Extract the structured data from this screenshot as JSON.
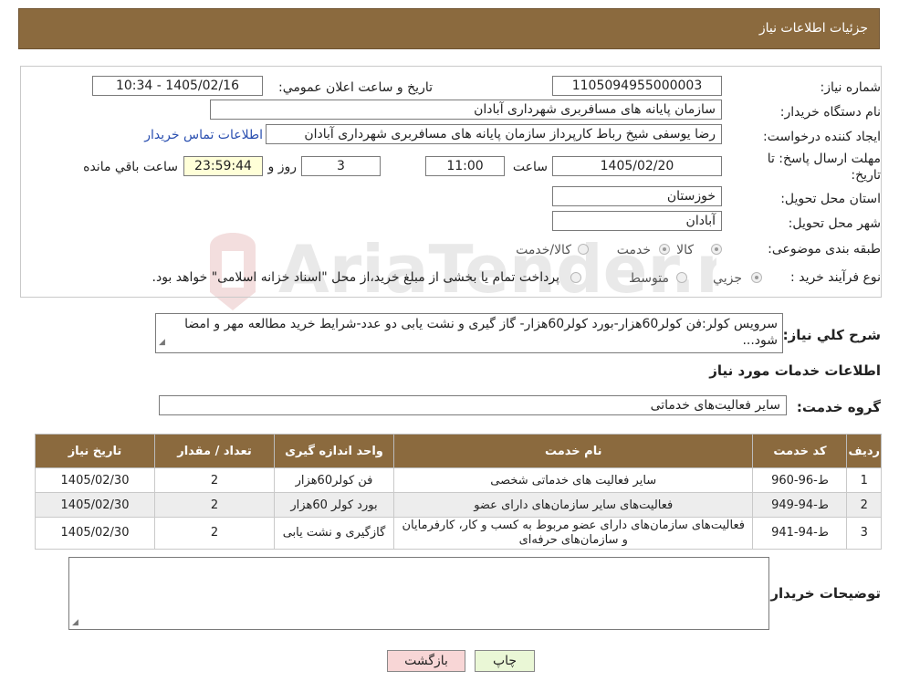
{
  "header": {
    "title": "جزئيات اطلاعات نياز"
  },
  "fields": {
    "need_number_label": "شماره نياز:",
    "need_number": "1105094955000003",
    "announce_label": "تاريخ و ساعت اعلان عمومي:",
    "announce_value": "1405/02/16 - 10:34",
    "buyer_label": "نام دستگاه خريدار:",
    "buyer_value": "سازمان پایانه های مسافربری شهرداری آبادان",
    "creator_label": "ايجاد کننده درخواست:",
    "creator_value": "رضا یوسفی شیخ رباط کارپرداز سازمان پایانه های مسافربری شهرداری آبادان",
    "contact_link": "اطلاعات تماس خريدار",
    "deadline_label": "مهلت ارسال پاسخ: تا تاريخ:",
    "deadline_date": "1405/02/20",
    "time_label": "ساعت",
    "deadline_time": "11:00",
    "days_value": "3",
    "days_label": "روز و",
    "remaining_value": "23:59:44",
    "remaining_label": "ساعت باقي مانده",
    "province_label": "استان محل تحويل:",
    "province_value": "خوزستان",
    "city_label": "شهر محل تحويل:",
    "city_value": "آبادان",
    "category_label": "طبقه بندی موضوعی:",
    "category_options": [
      "کالا",
      "خدمت",
      "کالا/خدمت"
    ],
    "purchase_label": "نوع فرآيند خريد :",
    "purchase_options": [
      "جزيي",
      "متوسط"
    ],
    "purchase_note": "پرداخت تمام يا بخشی از مبلغ خريد،از محل \"اسناد خزانه اسلامی\" خواهد بود."
  },
  "summary": {
    "label": "شرح کلي نياز:",
    "text": "سرویس کولر:فن کولر60هزار-بورد کولر60هزار- گاز گیری و نشت یابی دو عدد-شرایط خرید مطالعه مهر و امضا شود..."
  },
  "services": {
    "title": "اطلاعات خدمات مورد نياز",
    "group_label": "گروه خدمت:",
    "group_value": "سایر فعالیت‌های خدماتی",
    "columns": [
      "رديف",
      "کد خدمت",
      "نام خدمت",
      "واحد اندازه گيری",
      "تعداد / مقدار",
      "تاريخ نياز"
    ],
    "rows": [
      {
        "idx": "1",
        "code": "ط-96-960",
        "name": "سایر فعالیت های خدماتی شخصی",
        "unit": "فن کولر60هزار",
        "qty": "2",
        "date": "1405/02/30"
      },
      {
        "idx": "2",
        "code": "ط-94-949",
        "name": "فعالیت‌های سایر سازمان‌های دارای عضو",
        "unit": "بورد کولر 60هزار",
        "qty": "2",
        "date": "1405/02/30"
      },
      {
        "idx": "3",
        "code": "ط-94-941",
        "name": "فعالیت‌های سازمان‌های دارای عضو مربوط به کسب و کار، کارفرمایان و سازمان‌های حرفه‌ای",
        "unit": "گازگیری و نشت یابی",
        "qty": "2",
        "date": "1405/02/30"
      }
    ]
  },
  "notes": {
    "label": "توضيحات خريدار:"
  },
  "buttons": {
    "print": "چاپ",
    "back": "بازگشت"
  },
  "colors": {
    "header_bg": "#8b6a3e",
    "back_button_bg": "#f8d6d6",
    "print_button_bg": "#eaf7d6",
    "highlight_bg": "#ffffd8"
  }
}
